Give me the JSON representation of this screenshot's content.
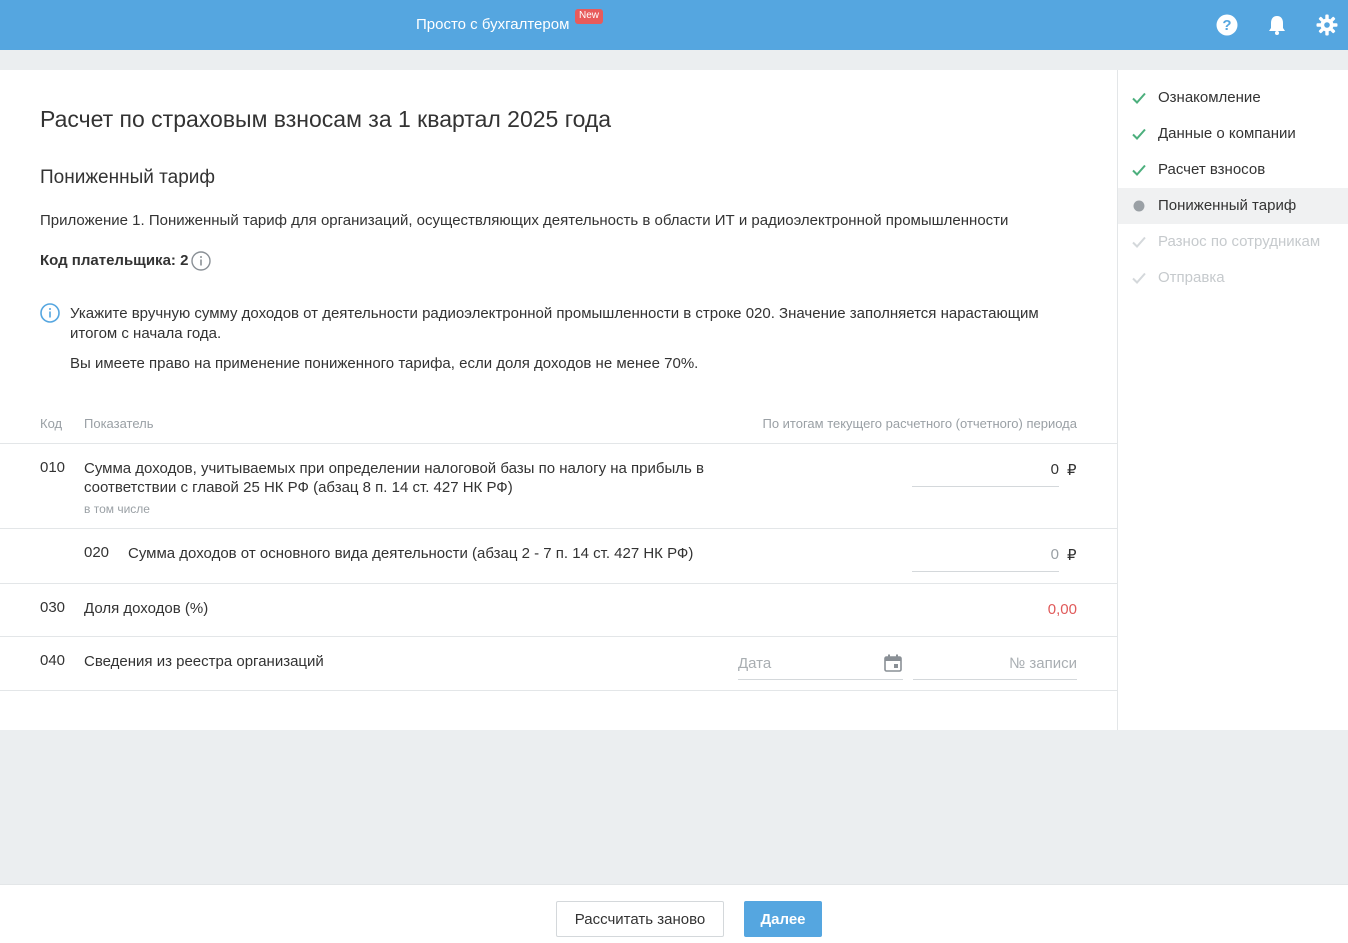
{
  "header": {
    "brand": "Просто с бухгалтером",
    "badge": "New",
    "icons": [
      "help-icon",
      "bell-icon",
      "gear-icon"
    ]
  },
  "page": {
    "title": "Расчет по страховым взносам за 1 квартал 2025 года",
    "section_title": "Пониженный тариф",
    "subtitle": "Приложение 1. Пониженный тариф для организаций, осуществляющих деятельность в области ИТ и радиоэлектронной промышленности",
    "payer_code": "Код плательщика: 2"
  },
  "notice": {
    "line1": "Укажите вручную сумму доходов от деятельности радиоэлектронной промышленности в строке 020. Значение заполняется нарастающим итогом с начала года.",
    "line2": "Вы имеете право на применение пониженного тарифа, если доля доходов не менее 70%."
  },
  "table": {
    "headers": {
      "code": "Код",
      "indicator": "Показатель",
      "period": "По итогам текущего расчетного (отчетного) периода"
    },
    "rows": [
      {
        "code": "010",
        "label": "Сумма доходов, учитываемых при определении налоговой базы по налогу на прибыль в соответствии с главой 25 НК РФ (абзац 8 п. 14 ст. 427 НК РФ)",
        "note": "в том числе",
        "value": "0",
        "currency": "₽"
      },
      {
        "code": "020",
        "label": "Сумма доходов от основного вида деятельности (абзац 2 - 7 п. 14 ст. 427 НК РФ)",
        "value": "0",
        "currency": "₽"
      },
      {
        "code": "030",
        "label": "Доля доходов (%)",
        "value": "0,00"
      },
      {
        "code": "040",
        "label": "Сведения из реестра организаций",
        "date_placeholder": "Дата",
        "record_placeholder": "№ записи"
      }
    ]
  },
  "steps": [
    {
      "label": "Ознакомление",
      "state": "done"
    },
    {
      "label": "Данные о компании",
      "state": "done"
    },
    {
      "label": "Расчет взносов",
      "state": "done"
    },
    {
      "label": "Пониженный тариф",
      "state": "active"
    },
    {
      "label": "Разнос по сотрудникам",
      "state": "disabled"
    },
    {
      "label": "Отправка",
      "state": "disabled"
    }
  ],
  "footer": {
    "recalc_label": "Рассчитать заново",
    "next_label": "Далее"
  },
  "colors": {
    "accent": "#55a6e0",
    "check": "#4caf7d",
    "red_value": "#e05a5a",
    "badge": "#e85b5b"
  }
}
